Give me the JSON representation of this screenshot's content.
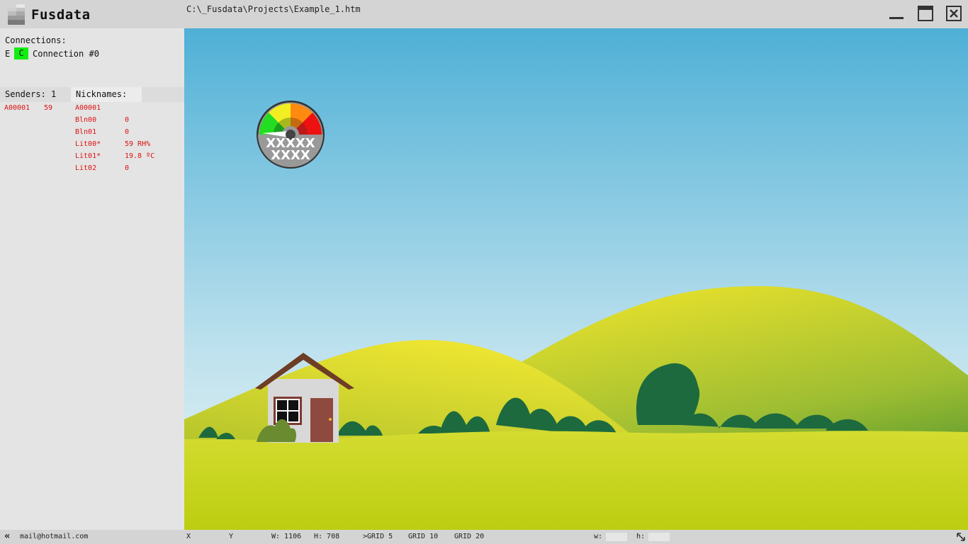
{
  "app": {
    "name": "Fusdata",
    "file_path": "C:\\_Fusdata\\Projects\\Example_1.htm"
  },
  "window_buttons": {
    "minimize": "minimize-icon",
    "maximize": "maximize-icon",
    "close": "close-icon"
  },
  "connections": {
    "title": "Connections:",
    "items": [
      {
        "e_label": "E",
        "c_label": "C",
        "name": "Connection #0",
        "status_color": "#11ee11"
      }
    ]
  },
  "tabs": {
    "senders": "Senders: 1",
    "nicknames": "Nicknames:"
  },
  "senders": [
    {
      "id": "A00001",
      "value": "59"
    }
  ],
  "nicknames": [
    {
      "name": "A00001",
      "value": ""
    },
    {
      "name": "Bln00",
      "value": "0"
    },
    {
      "name": "Bln01",
      "value": "0"
    },
    {
      "name": "Lit00*",
      "value": "59 RH%"
    },
    {
      "name": "Lit01*",
      "value": "19.8 ºC"
    },
    {
      "name": "Lit02",
      "value": "0"
    }
  ],
  "gauge": {
    "line1": "XXXXX",
    "line2": "XXXX"
  },
  "status_bar": {
    "collapse_icon": "double-chevron-left-icon",
    "email": "mail@hotmail.com",
    "x_label": "X",
    "y_label": "Y",
    "width": "W: 1106",
    "height": "H: 708",
    "grid5": ">GRID 5",
    "grid10": "GRID 10",
    "grid20": "GRID 20",
    "w_label": "w:",
    "h_label": "h:",
    "resize_icon": "resize-diagonal-icon"
  },
  "colors": {
    "text_red": "#dd1111",
    "connection_green": "#11ee11"
  }
}
